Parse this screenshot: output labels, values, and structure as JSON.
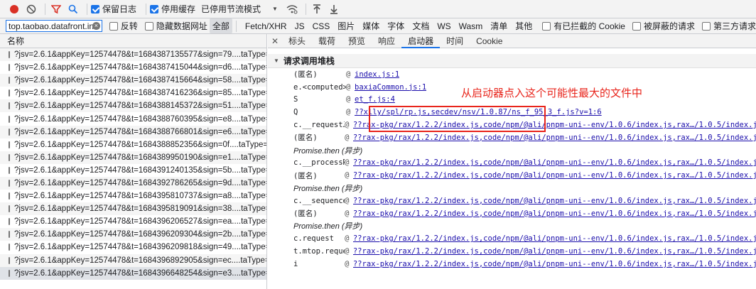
{
  "toolbar": {
    "preserve_log": "保留日志",
    "disable_cache": "停用缓存",
    "throttle": "已停用节流模式"
  },
  "filter": {
    "value": "top.taobao.datafront.invoke",
    "invert": "反转",
    "hide_data_urls": "隐藏数据网址",
    "types": [
      "全部",
      "Fetch/XHR",
      "JS",
      "CSS",
      "图片",
      "媒体",
      "字体",
      "文档",
      "WS",
      "Wasm",
      "清单",
      "其他"
    ],
    "blocked_cookies": "有已拦截的 Cookie",
    "blocked_requests": "被屏蔽的请求",
    "third_party": "第三方请求"
  },
  "list": {
    "header": "名称",
    "rows": [
      "?jsv=2.6.1&appKey=12574478&t=1684387135577&sign=79....taType=js...",
      "?jsv=2.6.1&appKey=12574478&t=1684387415044&sign=d6....taType=js...",
      "?jsv=2.6.1&appKey=12574478&t=1684387415664&sign=58....taType=js...",
      "?jsv=2.6.1&appKey=12574478&t=1684387416236&sign=85....taType=js...",
      "?jsv=2.6.1&appKey=12574478&t=1684388145372&sign=51....taType=js...",
      "?jsv=2.6.1&appKey=12574478&t=1684388760395&sign=e8....taType=js...",
      "?jsv=2.6.1&appKey=12574478&t=1684388766801&sign=e6....taType=js...",
      "?jsv=2.6.1&appKey=12574478&t=1684388852356&sign=0f....taType=js...",
      "?jsv=2.6.1&appKey=12574478&t=1684389950190&sign=e1....taType=js...",
      "?jsv=2.6.1&appKey=12574478&t=1684391240135&sign=5b....taType=js...",
      "?jsv=2.6.1&appKey=12574478&t=1684392786265&sign=9d....taType=js...",
      "?jsv=2.6.1&appKey=12574478&t=1684395810737&sign=a8....taType=js...",
      "?jsv=2.6.1&appKey=12574478&t=1684395819091&sign=38....taType=js...",
      "?jsv=2.6.1&appKey=12574478&t=1684396206527&sign=ea....taType=js...",
      "?jsv=2.6.1&appKey=12574478&t=1684396209304&sign=2b....taType=js...",
      "?jsv=2.6.1&appKey=12574478&t=1684396209818&sign=49....taType=js...",
      "?jsv=2.6.1&appKey=12574478&t=1684396892905&sign=ec....taType=js...",
      "?jsv=2.6.1&appKey=12574478&t=1684396648254&sign=e3....taType=js..."
    ]
  },
  "tabs": [
    "标头",
    "载荷",
    "预览",
    "响应",
    "启动器",
    "时间",
    "Cookie"
  ],
  "initiator": {
    "section_title": "请求调用堆栈",
    "frames": [
      {
        "fn": "(匿名)",
        "loc": "index.js:1",
        "async": false
      },
      {
        "fn": "e.<computed>",
        "loc": "baxiaCommon.js:1",
        "async": false
      },
      {
        "fn": "S",
        "loc": "et_f.js:4",
        "async": false
      },
      {
        "fn": "Q",
        "loc": "??xlly/spl/rp.js,secdev/nsv/1.0.87/ns_f_95_3_f.js?v=1:6",
        "async": false
      },
      {
        "fn": "c.__requestJSON",
        "loc": "??rax-pkg/rax/1.2.2/index.js,code/npm/@ali/pnpm-uni--env/1.0.6/index.js,rax…/1.0.5/index.js,",
        "async": false
      },
      {
        "fn": "(匿名)",
        "loc": "??rax-pkg/rax/1.2.2/index.js,code/npm/@ali/pnpm-uni--env/1.0.6/index.js,rax…/1.0.5/index.js,",
        "async": false
      },
      {
        "fn": "Promise.then (异步)",
        "loc": "",
        "async": true
      },
      {
        "fn": "c.__processRequest",
        "loc": "??rax-pkg/rax/1.2.2/index.js,code/npm/@ali/pnpm-uni--env/1.0.6/index.js,rax…/1.0.5/index.js,",
        "async": false
      },
      {
        "fn": "(匿名)",
        "loc": "??rax-pkg/rax/1.2.2/index.js,code/npm/@ali/pnpm-uni--env/1.0.6/index.js,rax…/1.0.5/index.js,",
        "async": false
      },
      {
        "fn": "Promise.then (异步)",
        "loc": "",
        "async": true
      },
      {
        "fn": "c.__sequence",
        "loc": "??rax-pkg/rax/1.2.2/index.js,code/npm/@ali/pnpm-uni--env/1.0.6/index.js,rax…/1.0.5/index.js,",
        "async": false
      },
      {
        "fn": "(匿名)",
        "loc": "??rax-pkg/rax/1.2.2/index.js,code/npm/@ali/pnpm-uni--env/1.0.6/index.js,rax…/1.0.5/index.js,",
        "async": false
      },
      {
        "fn": "Promise.then (异步)",
        "loc": "",
        "async": true
      },
      {
        "fn": "c.request",
        "loc": "??rax-pkg/rax/1.2.2/index.js,code/npm/@ali/pnpm-uni--env/1.0.6/index.js,rax…/1.0.5/index.js,",
        "async": false
      },
      {
        "fn": "t.mtop.request",
        "loc": "??rax-pkg/rax/1.2.2/index.js,code/npm/@ali/pnpm-uni--env/1.0.6/index.js,rax…/1.0.5/index.js,",
        "async": false
      },
      {
        "fn": "i",
        "loc": "??rax-pkg/rax/1.2.2/index.js,code/npm/@ali/pnpm-uni--env/1.0.6/index.js,rax…/1.0.5/index.js,",
        "async": false
      }
    ]
  },
  "annotation": "从启动器点入这个可能性最大的文件中",
  "colors": {
    "accent": "#1a73e8",
    "annotation": "#e8241b",
    "record": "#d93025",
    "link": "#1a0dab"
  }
}
